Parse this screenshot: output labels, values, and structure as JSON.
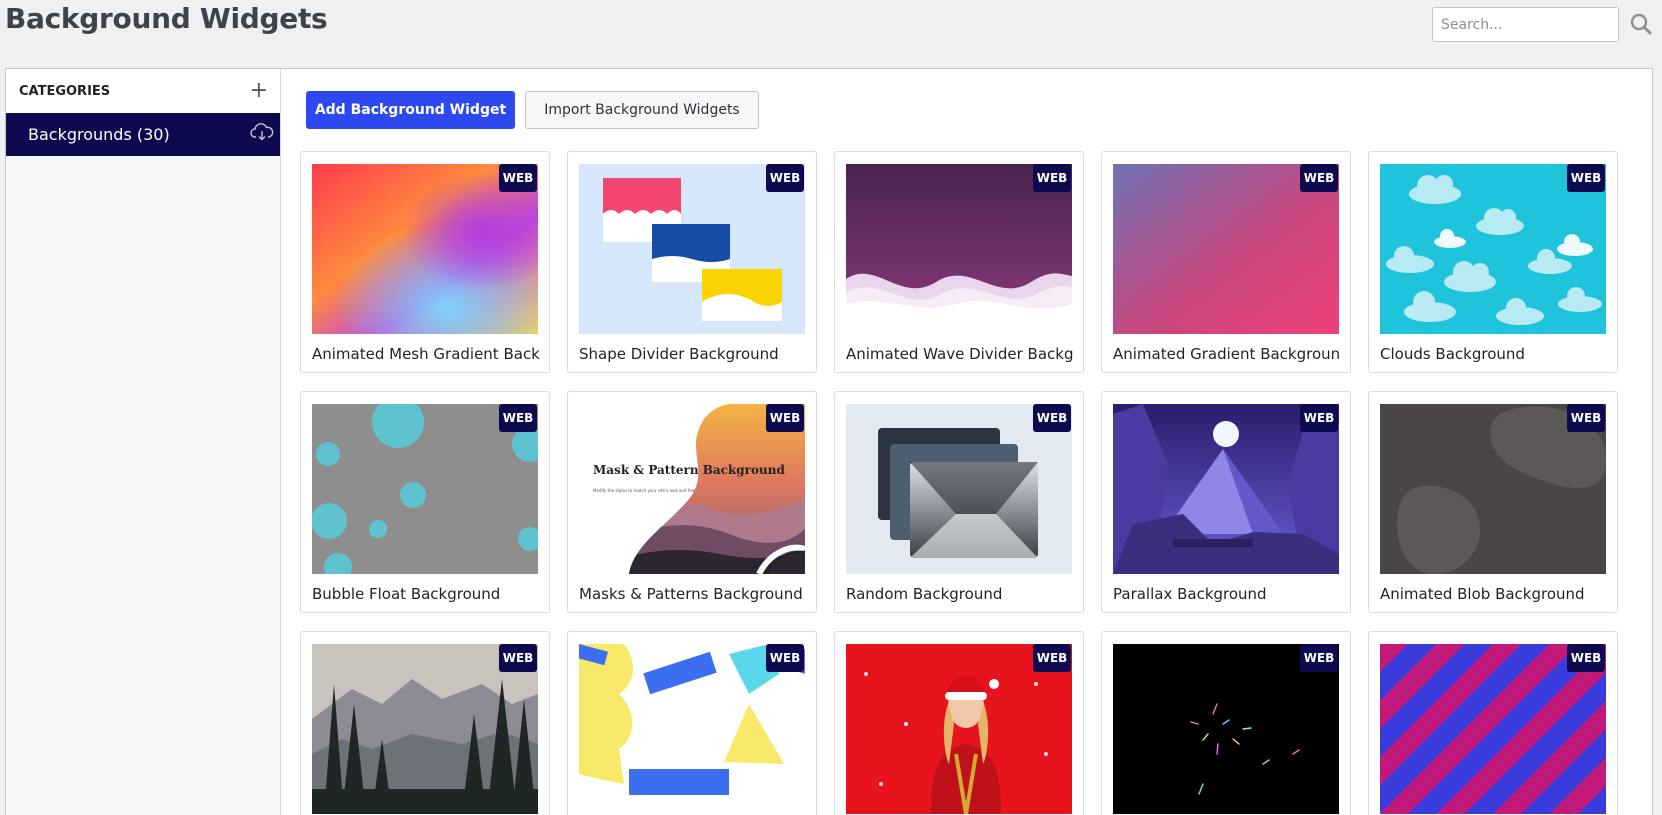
{
  "header": {
    "title": "Background Widgets",
    "search_placeholder": "Search..."
  },
  "sidebar": {
    "heading": "CATEGORIES",
    "add_symbol": "+",
    "items": [
      {
        "label": "Backgrounds (30)",
        "icon": "cloud-download-icon"
      }
    ]
  },
  "toolbar": {
    "add_label": "Add Background Widget",
    "import_label": "Import Background Widgets"
  },
  "badge_label": "WEB",
  "widgets": [
    {
      "title": "Animated Mesh Gradient Background"
    },
    {
      "title": "Shape Divider Background"
    },
    {
      "title": "Animated Wave Divider Background"
    },
    {
      "title": "Animated Gradient Background"
    },
    {
      "title": "Clouds Background"
    },
    {
      "title": "Bubble Float Background"
    },
    {
      "title": "Masks & Patterns Background",
      "thumb_text": "Mask & Pattern Background",
      "thumb_subtext": "Modify the styles to match your site's look and feel."
    },
    {
      "title": "Random Background"
    },
    {
      "title": "Parallax Background"
    },
    {
      "title": "Animated Blob Background"
    },
    {
      "title": ""
    },
    {
      "title": ""
    },
    {
      "title": ""
    },
    {
      "title": ""
    },
    {
      "title": ""
    }
  ],
  "colors": {
    "accent": "#2e48f0",
    "navy": "#0e0a4f"
  }
}
